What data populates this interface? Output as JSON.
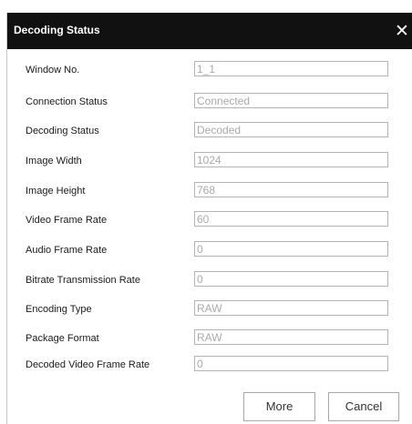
{
  "dialog": {
    "title": "Decoding Status",
    "close_icon": "close-icon"
  },
  "fields": [
    {
      "label": "Window No.",
      "value": "1_1"
    },
    {
      "label": "Connection Status",
      "value": "Connected"
    },
    {
      "label": "Decoding Status",
      "value": "Decoded"
    },
    {
      "label": "Image Width",
      "value": "1024"
    },
    {
      "label": "Image Height",
      "value": "768"
    },
    {
      "label": "Video Frame Rate",
      "value": "60"
    },
    {
      "label": "Audio Frame Rate",
      "value": "0"
    },
    {
      "label": "Bitrate Transmission Rate",
      "value": "0"
    },
    {
      "label": "Encoding Type",
      "value": "RAW"
    },
    {
      "label": "Package Format",
      "value": "RAW"
    },
    {
      "label": "Decoded Video Frame Rate",
      "value": "0"
    }
  ],
  "buttons": {
    "more": "More",
    "cancel": "Cancel"
  }
}
